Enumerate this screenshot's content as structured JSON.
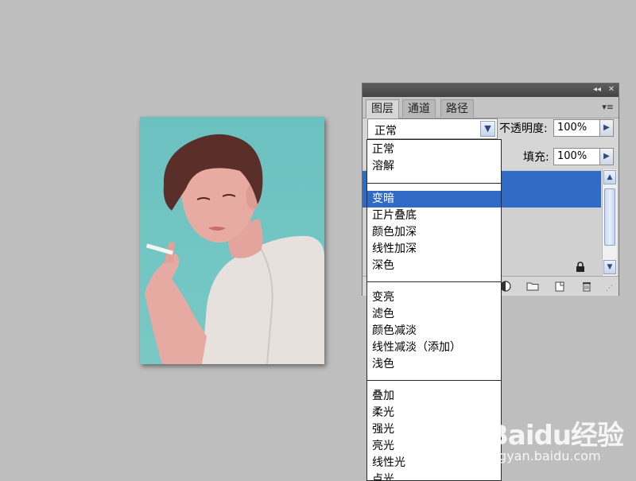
{
  "layers_panel": {
    "tabs": [
      "图层",
      "通道",
      "路径"
    ],
    "active_tab": "图层",
    "blend_mode": "正常",
    "opacity_label": "不透明度:",
    "opacity_value": "100%",
    "fill_label": "填充:",
    "fill_value": "100%"
  },
  "blend_menu": {
    "groups": [
      [
        "正常",
        "溶解"
      ],
      [
        "变暗",
        "正片叠底",
        "颜色加深",
        "线性加深",
        "深色"
      ],
      [
        "变亮",
        "滤色",
        "颜色减淡",
        "线性减淡（添加）",
        "浅色"
      ],
      [
        "叠加",
        "柔光",
        "强光",
        "亮光",
        "线性光",
        "点光"
      ]
    ],
    "selected": "变暗"
  },
  "watermark": {
    "brand": "Baidu经验",
    "url": "jingyan.baidu.com"
  },
  "colors": {
    "workspace": "#bebebe",
    "selection": "#316ac5",
    "photo_background": "#6bc1c0"
  }
}
